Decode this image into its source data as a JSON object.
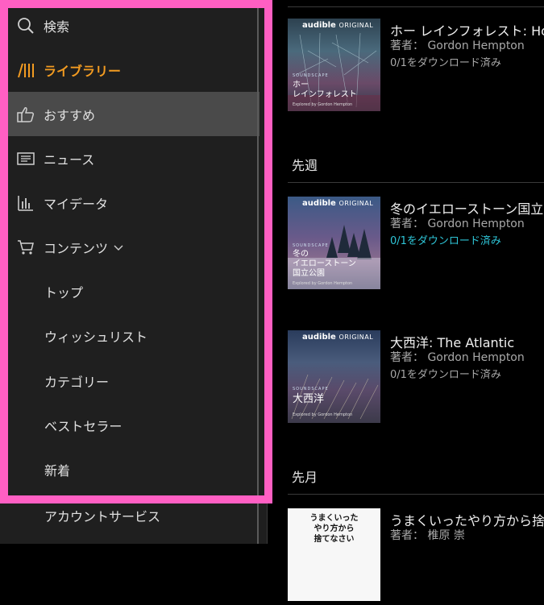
{
  "sidebar": {
    "search_label": "検索",
    "library_label": "ライブラリー",
    "recommend_label": "おすすめ",
    "news_label": "ニュース",
    "mydata_label": "マイデータ",
    "contents_label": "コンテンツ",
    "sub_items": [
      "トップ",
      "ウィッシュリスト",
      "カテゴリー",
      "ベストセラー",
      "新着"
    ],
    "account_label": "アカウントサービス"
  },
  "main": {
    "sections": [
      {
        "header": "先週"
      },
      {
        "header": "先月"
      }
    ],
    "books": [
      {
        "title": "ホー レインフォレスト: Hoh R",
        "author": "著者： Gordon Hempton",
        "download": "0/1をダウンロード済み",
        "cover_brand": "audible",
        "cover_brand_tag": "ORIGINAL",
        "cover_series": "SOUNDSCAPE",
        "cover_title": "ホー\nレインフォレスト",
        "cover_credit": "Explored by Gordon Hempton"
      },
      {
        "title": "冬のイエローストーン国立公",
        "author": "著者： Gordon Hempton",
        "download": "0/1をダウンロード済み",
        "cover_brand": "audible",
        "cover_brand_tag": "ORIGINAL",
        "cover_series": "SOUNDSCAPE",
        "cover_title": "冬の\nイエローストーン\n国立公園",
        "cover_credit": "Explored by Gordon Hempton"
      },
      {
        "title": "大西洋: The Atlantic",
        "author": "著者： Gordon Hempton",
        "download": "0/1をダウンロード済み",
        "cover_brand": "audible",
        "cover_brand_tag": "ORIGINAL",
        "cover_series": "SOUNDSCAPE",
        "cover_title": "大西洋",
        "cover_credit": "Explored by Gordon Hempton"
      },
      {
        "title": "うまくいったやり方から捨てな",
        "author": "著者： 椎原 崇",
        "cover_title": "うまくいった\nやり方から\n捨てなさい"
      }
    ]
  },
  "colors": {
    "accent": "#f29b21",
    "download_highlight": "#2ec4d6",
    "frame": "#ff5fc3",
    "sidebar_bg": "#1f1f1f",
    "selected_bg": "#4a4a4a"
  },
  "icons": {
    "search": "search-icon",
    "library": "library-icon",
    "recommend": "thumbs-up-icon",
    "news": "news-icon",
    "mydata": "bar-chart-icon",
    "contents": "cart-icon",
    "contents_expand": "chevron-down-icon"
  }
}
